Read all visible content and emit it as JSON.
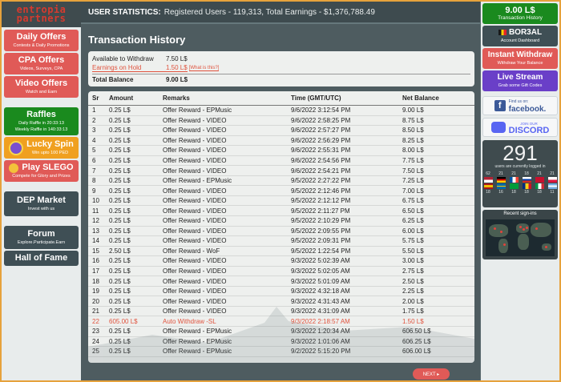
{
  "header": {
    "stats_label": "USER STATISTICS:",
    "stats_text": "Registered Users - 119,313, Total Earnings - $1,376,788.49"
  },
  "logo": {
    "line1": "entropia",
    "line2": "partners"
  },
  "left_menu": [
    {
      "title": "Daily Offers",
      "sub": "Contests & Daily Promotions"
    },
    {
      "title": "CPA Offers",
      "sub": "Videos, Surveys, CPA"
    },
    {
      "title": "Video Offers",
      "sub": "Watch and Earn"
    },
    {
      "title": "Raffles",
      "sub1": "Daily Raffle in 20:33:13",
      "sub2": "Weekly Raffle in 140:33:13"
    },
    {
      "title": "Lucky Spin",
      "sub": "Win upto 100 PED"
    },
    {
      "title": "Play SLEGO",
      "sub": "Compete for Glory and Prizes"
    },
    {
      "title": "DEP Market",
      "sub": "Invest with us"
    },
    {
      "title": "Forum",
      "sub": "Explore.Participate.Earn"
    },
    {
      "title": "Hall of Fame"
    }
  ],
  "page_title": "Transaction History",
  "balances": {
    "available_label": "Available to Withdraw",
    "available_value": "7.50 L$",
    "hold_label": "Earnings on Hold",
    "hold_value": "1.50 L$",
    "hold_help": "[What is this?]",
    "total_label": "Total Balance",
    "total_value": "9.00 L$"
  },
  "table": {
    "headers": [
      "Sr",
      "Amount",
      "Remarks",
      "Time (GMT/UTC)",
      "Net Balance"
    ],
    "rows": [
      [
        "1",
        "0.25 L$",
        "Offer Reward - EPMusic",
        "9/6/2022 3:12:54 PM",
        "9.00 L$"
      ],
      [
        "2",
        "0.25 L$",
        "Offer Reward - VIDEO",
        "9/6/2022 2:58:25 PM",
        "8.75 L$"
      ],
      [
        "3",
        "0.25 L$",
        "Offer Reward - VIDEO",
        "9/6/2022 2:57:27 PM",
        "8.50 L$"
      ],
      [
        "4",
        "0.25 L$",
        "Offer Reward - VIDEO",
        "9/6/2022 2:56:29 PM",
        "8.25 L$"
      ],
      [
        "5",
        "0.25 L$",
        "Offer Reward - VIDEO",
        "9/6/2022 2:55:31 PM",
        "8.00 L$"
      ],
      [
        "6",
        "0.25 L$",
        "Offer Reward - VIDEO",
        "9/6/2022 2:54:56 PM",
        "7.75 L$"
      ],
      [
        "7",
        "0.25 L$",
        "Offer Reward - VIDEO",
        "9/6/2022 2:54:21 PM",
        "7.50 L$"
      ],
      [
        "8",
        "0.25 L$",
        "Offer Reward - EPMusic",
        "9/5/2022 2:27:22 PM",
        "7.25 L$"
      ],
      [
        "9",
        "0.25 L$",
        "Offer Reward - VIDEO",
        "9/5/2022 2:12:46 PM",
        "7.00 L$"
      ],
      [
        "10",
        "0.25 L$",
        "Offer Reward - VIDEO",
        "9/5/2022 2:12:12 PM",
        "6.75 L$"
      ],
      [
        "11",
        "0.25 L$",
        "Offer Reward - VIDEO",
        "9/5/2022 2:11:27 PM",
        "6.50 L$"
      ],
      [
        "12",
        "0.25 L$",
        "Offer Reward - VIDEO",
        "9/5/2022 2:10:29 PM",
        "6.25 L$"
      ],
      [
        "13",
        "0.25 L$",
        "Offer Reward - VIDEO",
        "9/5/2022 2:09:55 PM",
        "6.00 L$"
      ],
      [
        "14",
        "0.25 L$",
        "Offer Reward - VIDEO",
        "9/5/2022 2:09:31 PM",
        "5.75 L$"
      ],
      [
        "15",
        "2.50 L$",
        "Offer Reward - WoF",
        "9/5/2022 1:22:54 PM",
        "5.50 L$"
      ],
      [
        "16",
        "0.25 L$",
        "Offer Reward - VIDEO",
        "9/3/2022 5:02:39 AM",
        "3.00 L$"
      ],
      [
        "17",
        "0.25 L$",
        "Offer Reward - VIDEO",
        "9/3/2022 5:02:05 AM",
        "2.75 L$"
      ],
      [
        "18",
        "0.25 L$",
        "Offer Reward - VIDEO",
        "9/3/2022 5:01:09 AM",
        "2.50 L$"
      ],
      [
        "19",
        "0.25 L$",
        "Offer Reward - VIDEO",
        "9/3/2022 4:32:18 AM",
        "2.25 L$"
      ],
      [
        "20",
        "0.25 L$",
        "Offer Reward - VIDEO",
        "9/3/2022 4:31:43 AM",
        "2.00 L$"
      ],
      [
        "21",
        "0.25 L$",
        "Offer Reward - VIDEO",
        "9/3/2022 4:31:09 AM",
        "1.75 L$"
      ],
      [
        "22",
        "605.00 L$",
        "Auto Withdraw -SL",
        "9/3/2022 2:18:57 AM",
        "1.50 L$"
      ],
      [
        "23",
        "0.25 L$",
        "Offer Reward - EPMusic",
        "9/3/2022 1:20:34 AM",
        "606.50 L$"
      ],
      [
        "24",
        "0.25 L$",
        "Offer Reward - EPMusic",
        "9/3/2022 1:01:06 AM",
        "606.25 L$"
      ],
      [
        "25",
        "0.25 L$",
        "Offer Reward - EPMusic",
        "9/2/2022 5:15:20 PM",
        "606.00 L$"
      ]
    ],
    "highlight_row": 22
  },
  "pager": {
    "next_label": "NEXT ▸"
  },
  "right_panel": {
    "balance_value": "9.00 L$",
    "balance_sub": "Transaction History",
    "account_name": "BOR3AL",
    "account_sub": "Account Dashboard",
    "withdraw_title": "Instant Withdraw",
    "withdraw_sub": "Withdraw Your Balance",
    "stream_title": "Live Stream",
    "stream_sub": "Grab some Gift Codes",
    "facebook_small": "Find us on:",
    "facebook_label": "facebook.",
    "discord_small": "JOIN OUR",
    "discord_label": "DISCORD",
    "online_count": "291",
    "online_label": "users are currently logged in",
    "flag_counts_row1": [
      "62",
      "21",
      "21",
      "18",
      "21",
      "21"
    ],
    "flag_counts_row2": [
      "18",
      "16",
      "18",
      "18",
      "18",
      "11"
    ],
    "signins_label": "Recent sign-ins"
  },
  "colors": {
    "accent_red": "#e05a57",
    "accent_green": "#1a8a1e",
    "accent_purple": "#6a3fc8",
    "accent_orange": "#f0a020",
    "hold_red": "#e0533e"
  }
}
